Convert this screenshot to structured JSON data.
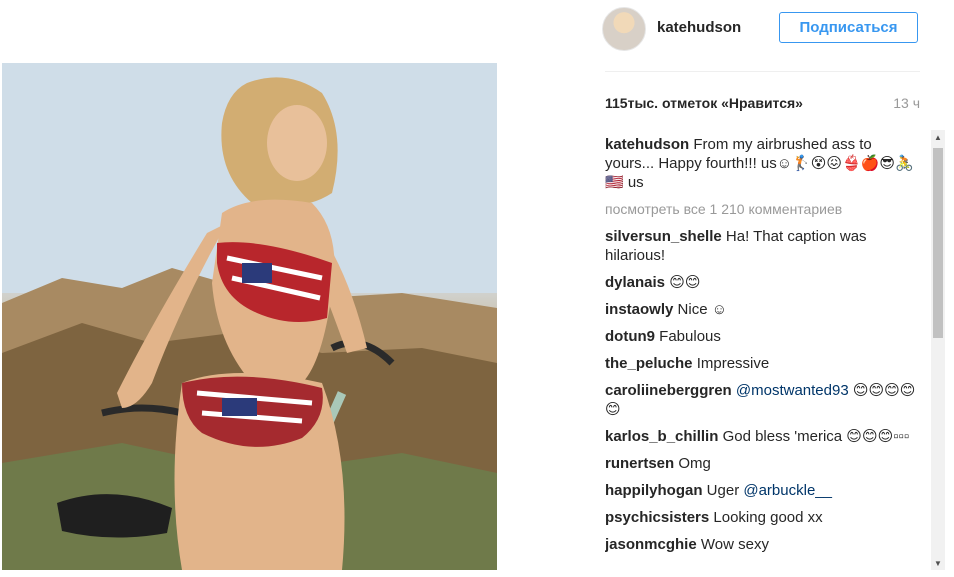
{
  "post": {
    "author": "katehudson",
    "follow_label": "Подписаться",
    "likes": "115тыс. отметок «Нравится»",
    "time": "13 ч"
  },
  "caption": {
    "user": "katehudson",
    "text": "From my airbrushed ass to yours... Happy fourth!!! us☺🏌😵😖👙🍎😎🚴🇺🇸 us"
  },
  "view_all_label": "посмотреть все 1 210 комментариев",
  "comments": [
    {
      "user": "silversun_shelle",
      "text": "Ha! That caption was hilarious!"
    },
    {
      "user": "dylanais",
      "text": "😊😊"
    },
    {
      "user": "instaowly",
      "text": "Nice ☺"
    },
    {
      "user": "dotun9",
      "text": "Fabulous"
    },
    {
      "user": "the_peluche",
      "text": "Impressive"
    },
    {
      "user": "caroliineberggren",
      "mention": "@mostwanted93",
      "text": " 😊😊😊😊😊"
    },
    {
      "user": "karlos_b_chillin",
      "text": "God bless 'merica 😊😊😊▫▫▫"
    },
    {
      "user": "runertsen",
      "text": "Omg"
    },
    {
      "user": "happilyhogan",
      "text": "Uger ",
      "mention": "@arbuckle__"
    },
    {
      "user": "psychicsisters",
      "text": "Looking good xx"
    },
    {
      "user": "jasonmcghie",
      "text": "Wow sexy"
    }
  ]
}
